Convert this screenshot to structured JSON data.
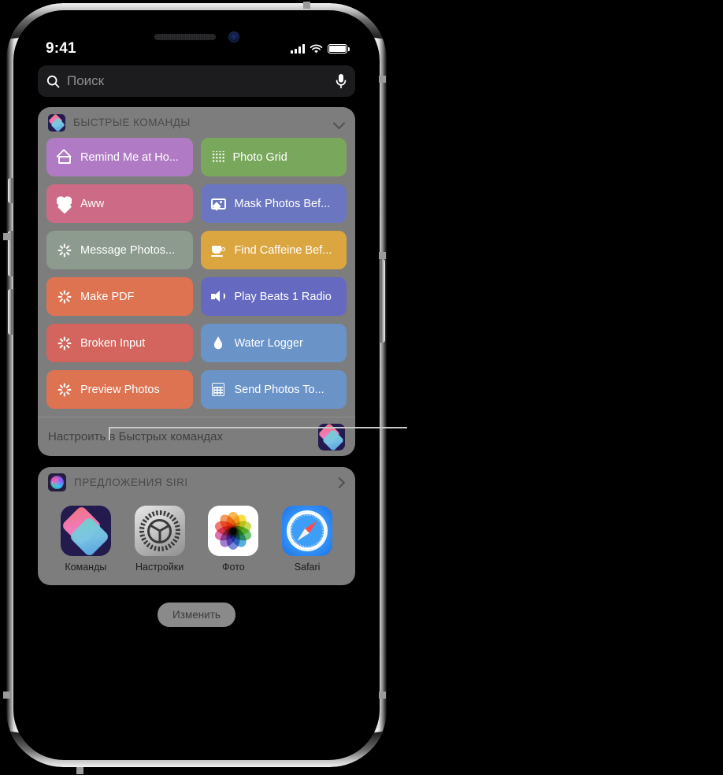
{
  "status_bar": {
    "time": "9:41",
    "signal_icon": "cellular-signal-icon",
    "wifi_icon": "wifi-icon",
    "battery_icon": "battery-icon"
  },
  "search": {
    "placeholder": "Поиск",
    "icon": "search-icon",
    "mic_icon": "microphone-icon"
  },
  "shortcuts_widget": {
    "title": "БЫСТРЫЕ КОМАНДЫ",
    "app_icon": "shortcuts-app-icon",
    "collapse_icon": "chevron-down-icon",
    "footer_text": "Настроить в Быстрых командах",
    "footer_icon": "shortcuts-app-icon",
    "tiles": [
      {
        "label": "Remind Me at Ho...",
        "icon": "house-icon",
        "color": "#b07bc4"
      },
      {
        "label": "Photo Grid",
        "icon": "grid-dots-icon",
        "color": "#79a85c"
      },
      {
        "label": "Aww",
        "icon": "heart-icon",
        "color": "#cd6a85"
      },
      {
        "label": "Mask Photos Bef...",
        "icon": "photo-icon",
        "color": "#6b76c0"
      },
      {
        "label": "Message Photos...",
        "icon": "sparkle-burst-icon",
        "color": "#8d9b8e"
      },
      {
        "label": "Find Caffeine Bef...",
        "icon": "coffee-cup-icon",
        "color": "#dbaráí"
      },
      {
        "label": "Make PDF",
        "icon": "sparkle-burst-icon",
        "color": "#de7352"
      },
      {
        "label": "Play Beats 1 Radio",
        "icon": "speaker-icon",
        "color": "#6569bf"
      },
      {
        "label": "Broken Input",
        "icon": "sparkle-burst-icon",
        "color": "#d4655e"
      },
      {
        "label": "Water Logger",
        "icon": "water-drop-icon",
        "color": "#6a93c8"
      },
      {
        "label": "Preview Photos",
        "icon": "sparkle-burst-icon",
        "color": "#de7352"
      },
      {
        "label": "Send Photos To...",
        "icon": "table-grid-icon",
        "color": "#6a93c8"
      }
    ]
  },
  "siri_widget": {
    "title": "ПРЕДЛОЖЕНИЯ SIRI",
    "siri_icon": "siri-orb-icon",
    "more_icon": "chevron-right-icon",
    "apps": [
      {
        "label": "Команды",
        "icon": "shortcuts-app-icon"
      },
      {
        "label": "Настройки",
        "icon": "settings-gear-icon"
      },
      {
        "label": "Фото",
        "icon": "photos-app-icon"
      },
      {
        "label": "Safari",
        "icon": "safari-compass-icon"
      }
    ]
  },
  "edit_button": {
    "label": "Изменить"
  },
  "colors": {
    "widget_background": "#7d7d7d",
    "search_background": "#1c1c1e",
    "screen_background": "#000000",
    "placeholder_text": "#8e8e93",
    "caffeine_tile": "#dba63f"
  },
  "photos_petals": [
    "#f5a623",
    "#f8d41e",
    "#b6d634",
    "#4eb84e",
    "#2e9fd4",
    "#5a6fd0",
    "#8e5fc4",
    "#d4539f",
    "#ef5a52",
    "#f2843c"
  ],
  "device": {
    "left_buttons": [
      "silent-switch",
      "volume-up-button",
      "volume-down-button"
    ],
    "right_buttons": [
      "power-button"
    ],
    "island": [
      "speaker-grille",
      "front-camera-lens"
    ]
  }
}
